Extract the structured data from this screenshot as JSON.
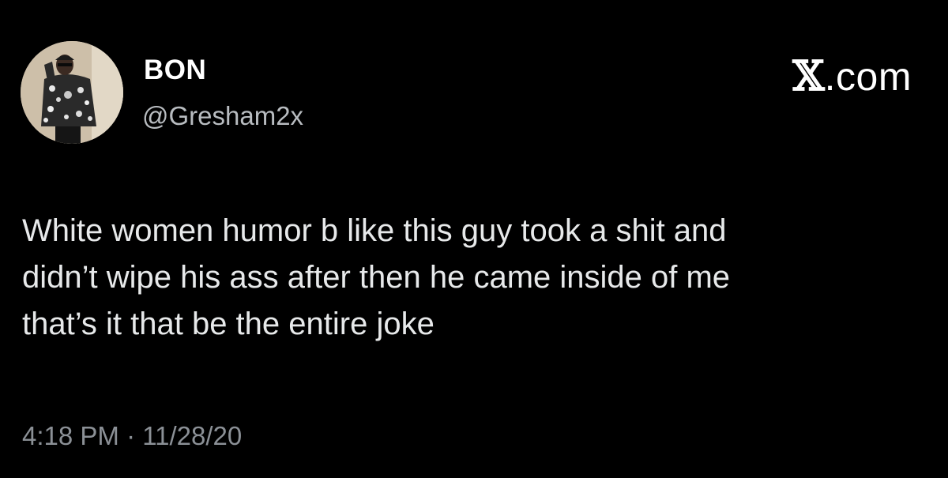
{
  "tweet": {
    "author": {
      "display_name": "BON",
      "handle": "@Gresham2x"
    },
    "brand": {
      "x_mark": "𝕏",
      "rest": ".com"
    },
    "text": "White women humor b like this guy took a shit and\ndidn’t wipe his ass after then he came inside of me\nthat’s it that be the entire joke",
    "timestamp": "4:18 PM · 11/28/20"
  },
  "colors": {
    "background": "#000000",
    "name": "#ffffff",
    "body_text": "#e7e9ea",
    "handle": "#b8bcc0",
    "timestamp": "#8b9096"
  }
}
